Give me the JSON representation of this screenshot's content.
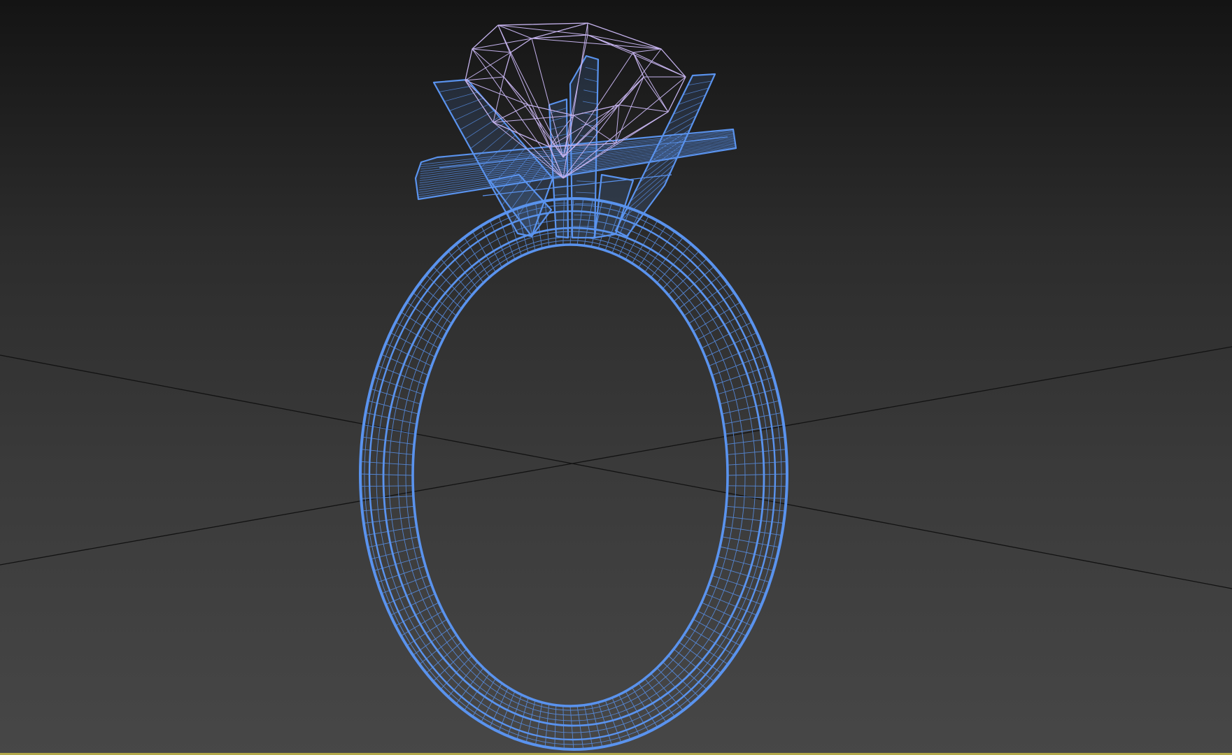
{
  "viewport": {
    "label": "",
    "shading_mode": "wireframe",
    "background": {
      "top": "#141414",
      "bottom": "#474747"
    }
  },
  "scene": {
    "objects": [
      {
        "name": "ring-band",
        "display": "wireframe",
        "color": "#5a93ee"
      },
      {
        "name": "prong-setting",
        "display": "wireframe",
        "color": "#5a93ee"
      },
      {
        "name": "gemstone",
        "display": "wireframe",
        "color": "#c4b2ec"
      }
    ],
    "grid_axes_color": "#111111",
    "viewport_border_color": "#b3a94a"
  }
}
